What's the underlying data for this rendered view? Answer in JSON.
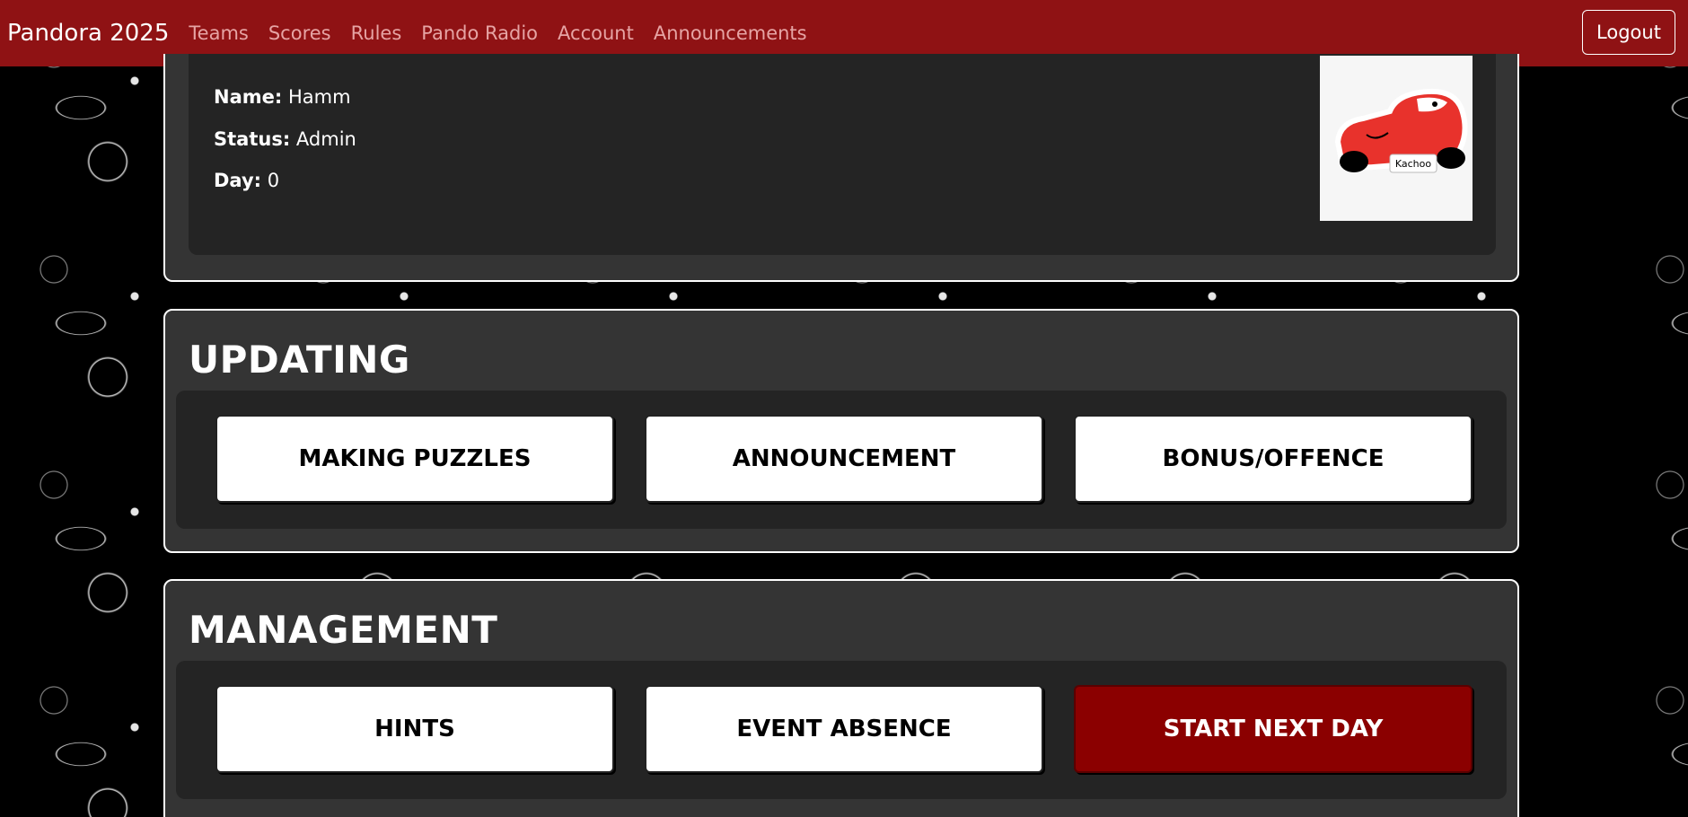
{
  "navbar": {
    "brand": "Pandora 2025",
    "links": [
      "Teams",
      "Scores",
      "Rules",
      "Pando Radio",
      "Account",
      "Announcements"
    ],
    "logout_label": "Logout"
  },
  "profile": {
    "name_label": "Name:",
    "name_value": "Hamm",
    "status_label": "Status:",
    "status_value": "Admin",
    "day_label": "Day:",
    "day_value": "0",
    "image_caption": "Kachoo"
  },
  "updating": {
    "title": "UPDATING",
    "buttons": [
      "MAKING PUZZLES",
      "ANNOUNCEMENT",
      "BONUS/OFFENCE"
    ]
  },
  "management": {
    "title": "MANAGEMENT",
    "buttons": [
      "HINTS",
      "EVENT ABSENCE",
      "START NEXT DAY"
    ]
  },
  "colors": {
    "navbar": "#8f1214",
    "danger_button": "#8b0000",
    "panel": "#343434",
    "panel_inner": "#242424"
  },
  "icons": {
    "profile_image": "red-cartoon-car-icon"
  }
}
